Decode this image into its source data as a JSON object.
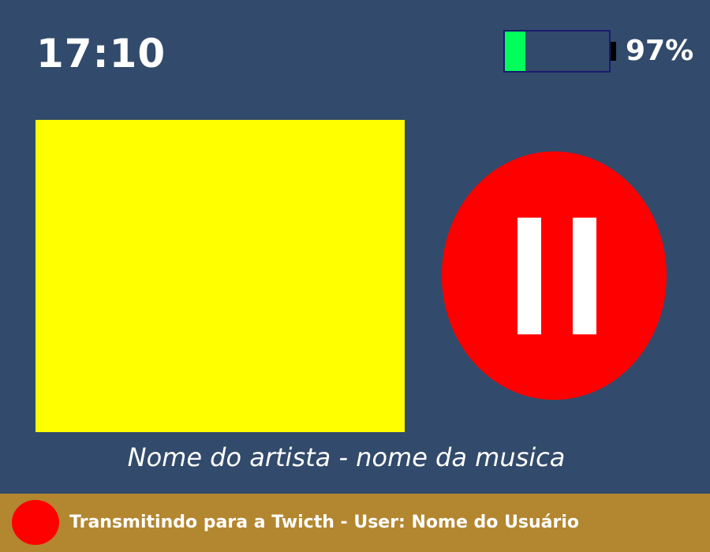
{
  "status_bar": {
    "time": "17:10",
    "battery": {
      "level_percent": 97,
      "label": "97%",
      "fill_color": "#00ff5a"
    }
  },
  "player": {
    "album_art_color": "#ffff00",
    "playback_button": {
      "icon": "pause-icon",
      "color": "#ff0000"
    },
    "now_playing": "Nome do artista - nome da musica"
  },
  "footer": {
    "live_indicator_color": "#ff0000",
    "text": "Transmitindo para a Twicth - User: Nome do Usuário"
  },
  "colors": {
    "background": "#324a6b",
    "footer_background": "#b38630",
    "text": "#ffffff"
  }
}
